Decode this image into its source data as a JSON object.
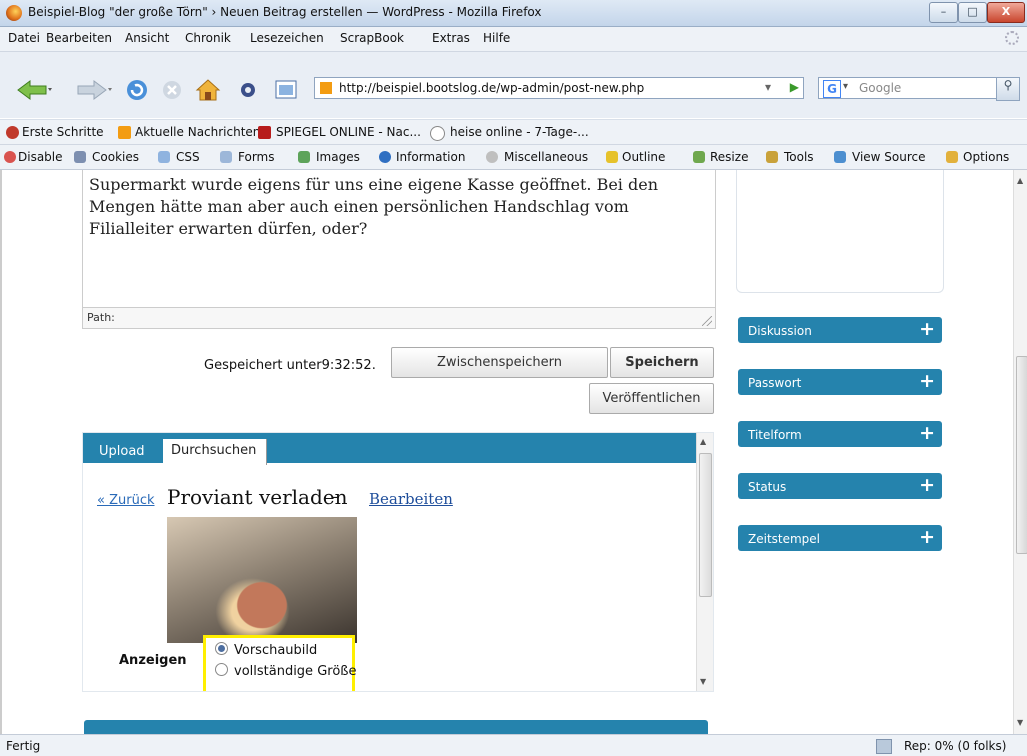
{
  "window": {
    "title": "Beispiel-Blog \"der große Törn\" › Neuen Beitrag erstellen — WordPress - Mozilla Firefox",
    "minimize": "–",
    "maximize": "□",
    "close": "X"
  },
  "menu": [
    "Datei",
    "Bearbeiten",
    "Ansicht",
    "Chronik",
    "Lesezeichen",
    "ScrapBook",
    "Extras",
    "Hilfe"
  ],
  "nav": {
    "url": "http://beispiel.bootslog.de/wp-admin/post-new.php",
    "search_placeholder": "Google",
    "search_engine": "G"
  },
  "bookmarks": [
    "Erste Schritte",
    "Aktuelle Nachrichten",
    "SPIEGEL ONLINE - Nac...",
    "heise online - 7-Tage-..."
  ],
  "webdev": [
    "Disable",
    "Cookies",
    "CSS",
    "Forms",
    "Images",
    "Information",
    "Miscellaneous",
    "Outline",
    "Resize",
    "Tools",
    "View Source",
    "Options"
  ],
  "editor": {
    "text": "Supermarkt wurde eigens für uns eine eigene Kasse geöffnet. Bei den Mengen hätte man aber auch einen persönlichen Handschlag vom Filialleiter erwarten dürfen, oder?",
    "path_label": "Path:"
  },
  "actions": {
    "saved_status": "Gespeichert unter9:32:52.",
    "draft": "Zwischenspeichern",
    "save": "Speichern",
    "publish": "Veröffentlichen"
  },
  "media": {
    "tabs": [
      "Upload",
      "Durchsuchen"
    ],
    "back": "« Zurück",
    "title": "Proviant verladen",
    "dash": "–",
    "edit": "Bearbeiten",
    "show_label": "Anzeigen",
    "options": [
      "Vorschaubild",
      "vollständige Größe"
    ],
    "selected_option": "Vorschaubild"
  },
  "sidebar": [
    "Diskussion",
    "Passwort",
    "Titelform",
    "Status",
    "Zeitstempel"
  ],
  "status": {
    "text": "Fertig",
    "rep": "Rep: 0% (0 folks)"
  },
  "colors": {
    "wp_blue": "#2583ad",
    "highlight": "#ffef00"
  }
}
